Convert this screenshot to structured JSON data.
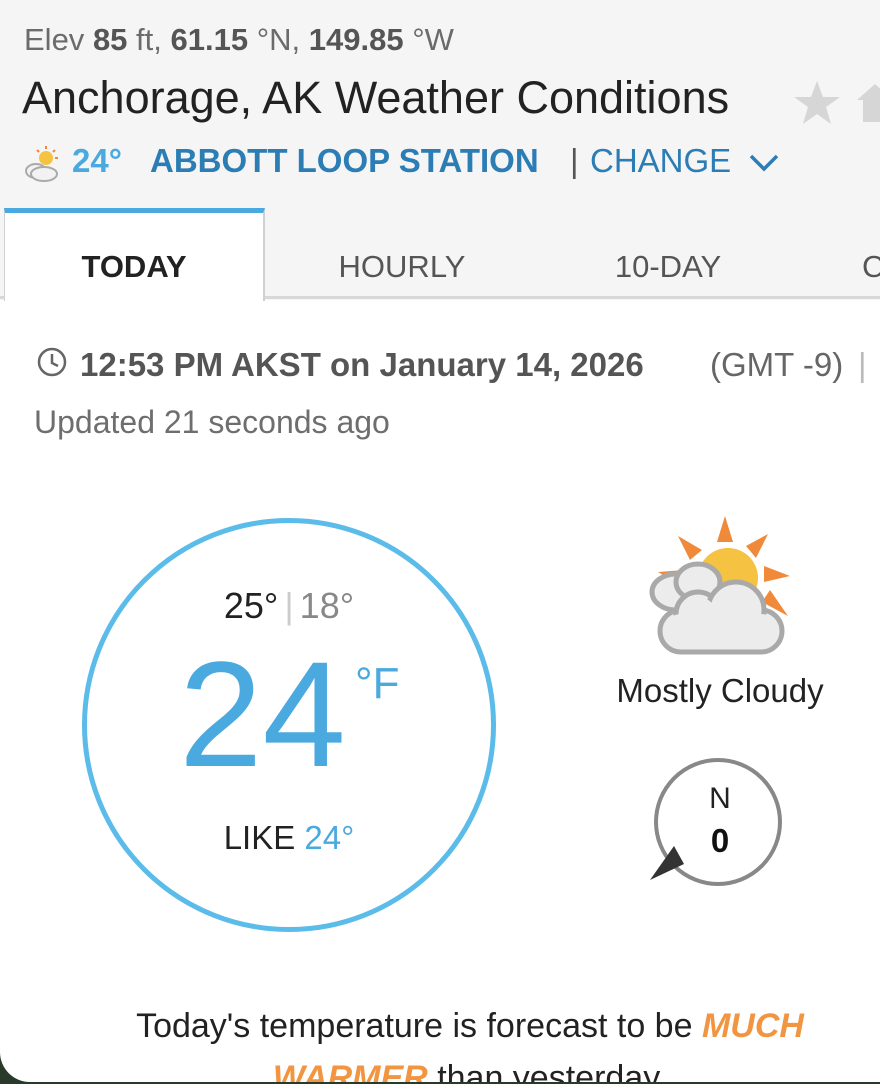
{
  "location": {
    "elev_prefix": "Elev",
    "elev_value": "85",
    "elev_unit": "ft,",
    "lat_value": "61.15",
    "lat_unit": "°N,",
    "lon_value": "149.85",
    "lon_unit": "°W",
    "title": "Anchorage, AK Weather Conditions"
  },
  "station": {
    "temp": "24°",
    "name": "ABBOTT LOOP STATION",
    "separator": "|",
    "change_label": "CHANGE"
  },
  "tabs": [
    {
      "label": "TODAY",
      "active": true
    },
    {
      "label": "HOURLY"
    },
    {
      "label": "10-DAY"
    },
    {
      "label": "C"
    }
  ],
  "observation": {
    "time": "12:53 PM AKST on January 14, 2026",
    "gmt": "(GMT -9)",
    "separator": "|",
    "updated": "Updated 21 seconds ago"
  },
  "current": {
    "high": "25°",
    "hi_lo_sep": "|",
    "low": "18°",
    "temp": "24",
    "unit": "°F",
    "feels_like_label": "LIKE",
    "feels_like_value": "24°",
    "condition": "Mostly Cloudy",
    "condition_icon": "mostly-cloudy-icon"
  },
  "wind": {
    "direction": "N",
    "speed": "0"
  },
  "summary": {
    "prefix": "Today's temperature is forecast to be",
    "emphasis": "MUCH WARMER",
    "suffix": "than yesterday."
  },
  "colors": {
    "accent_blue": "#4aa9de",
    "link_blue": "#2d7db5",
    "emphasis_orange": "#f29540"
  }
}
